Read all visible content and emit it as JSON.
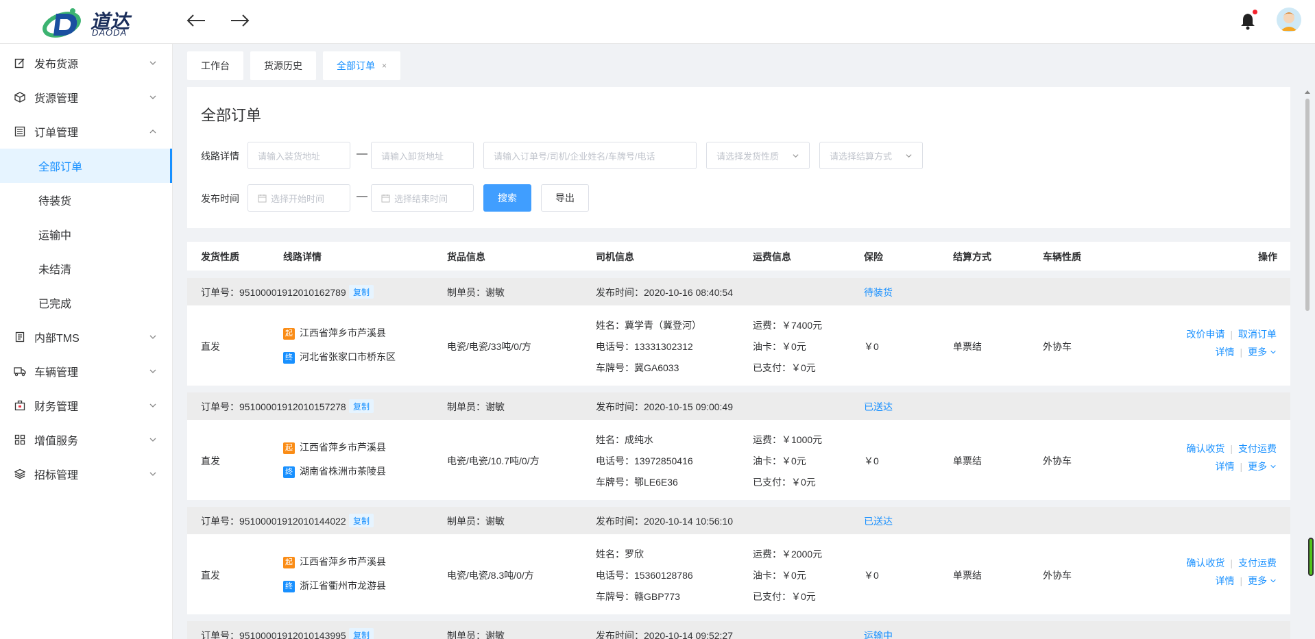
{
  "brand": {
    "cn": "道达",
    "en": "DAODA"
  },
  "sidebar": {
    "menus": [
      {
        "label": "发布货源",
        "icon": "edit-icon"
      },
      {
        "label": "货源管理",
        "icon": "cube-icon"
      },
      {
        "label": "订单管理",
        "icon": "list-icon"
      },
      {
        "label": "内部TMS",
        "icon": "document-icon"
      },
      {
        "label": "车辆管理",
        "icon": "truck-icon"
      },
      {
        "label": "财务管理",
        "icon": "briefcase-icon"
      },
      {
        "label": "增值服务",
        "icon": "grid-icon"
      },
      {
        "label": "招标管理",
        "icon": "layers-icon"
      }
    ],
    "order_sub": [
      "全部订单",
      "待装货",
      "运输中",
      "未结清",
      "已完成"
    ]
  },
  "tabs": [
    {
      "label": "工作台"
    },
    {
      "label": "货源历史"
    },
    {
      "label": "全部订单"
    }
  ],
  "tab_close": "×",
  "filter": {
    "title": "全部订单",
    "route_label": "线路详情",
    "load_placeholder": "请输入装货地址",
    "unload_placeholder": "请输入卸货地址",
    "keyword_placeholder": "请输入订单号/司机/企业姓名/车牌号/电话",
    "ship_type_placeholder": "请选择发货性质",
    "settle_placeholder": "请选择结算方式",
    "time_label": "发布时间",
    "start_placeholder": "选择开始时间",
    "end_placeholder": "选择结束时间",
    "dash": "—",
    "search_btn": "搜索",
    "export_btn": "导出"
  },
  "columns": [
    "发货性质",
    "线路详情",
    "货品信息",
    "司机信息",
    "运费信息",
    "保险",
    "结算方式",
    "车辆性质",
    "操作"
  ],
  "labels": {
    "order_no": "订单号：",
    "copy": "复制",
    "maker": "制单员：",
    "publish_time": "发布时间：",
    "start_badge": "起",
    "end_badge": "终",
    "driver_name": "姓名：",
    "driver_phone": "电话号：",
    "plate": "车牌号：",
    "freight": "运费：",
    "oil_card": "油卡：",
    "paid": "已支付：",
    "more": "更多"
  },
  "orders": [
    {
      "order_no": "95100001912010162789",
      "maker": "谢敏",
      "publish_time": "2020-10-16 08:40:54",
      "status": "待装货",
      "ship_type": "直发",
      "from": "江西省萍乡市芦溪县",
      "to": "河北省张家口市桥东区",
      "goods": "电瓷/电瓷/33吨/0/方",
      "driver_name": "冀学青（冀登河）",
      "driver_phone": "13331302312",
      "plate": "冀GA6033",
      "freight": "￥7400元",
      "oil_card": "￥0元",
      "paid": "￥0元",
      "insurance": "￥0",
      "settle": "单票结",
      "vehicle": "外协车",
      "action1": "改价申请",
      "action2": "取消订单",
      "action3": "详情"
    },
    {
      "order_no": "95100001912010157278",
      "maker": "谢敏",
      "publish_time": "2020-10-15 09:00:49",
      "status": "已送达",
      "ship_type": "直发",
      "from": "江西省萍乡市芦溪县",
      "to": "湖南省株洲市茶陵县",
      "goods": "电瓷/电瓷/10.7吨/0/方",
      "driver_name": "成纯水",
      "driver_phone": "13972850416",
      "plate": "鄂LE6E36",
      "freight": "￥1000元",
      "oil_card": "￥0元",
      "paid": "￥0元",
      "insurance": "￥0",
      "settle": "单票结",
      "vehicle": "外协车",
      "action1": "确认收货",
      "action2": "支付运费",
      "action3": "详情"
    },
    {
      "order_no": "95100001912010144022",
      "maker": "谢敏",
      "publish_time": "2020-10-14 10:56:10",
      "status": "已送达",
      "ship_type": "直发",
      "from": "江西省萍乡市芦溪县",
      "to": "浙江省衢州市龙游县",
      "goods": "电瓷/电瓷/8.3吨/0/方",
      "driver_name": "罗欣",
      "driver_phone": "15360128786",
      "plate": "赣GBP773",
      "freight": "￥2000元",
      "oil_card": "￥0元",
      "paid": "￥0元",
      "insurance": "￥0",
      "settle": "单票结",
      "vehicle": "外协车",
      "action1": "确认收货",
      "action2": "支付运费",
      "action3": "详情"
    },
    {
      "order_no": "95100001912010143995",
      "maker": "谢敏",
      "publish_time": "2020-10-14 09:52:27",
      "status": "运输中"
    }
  ]
}
